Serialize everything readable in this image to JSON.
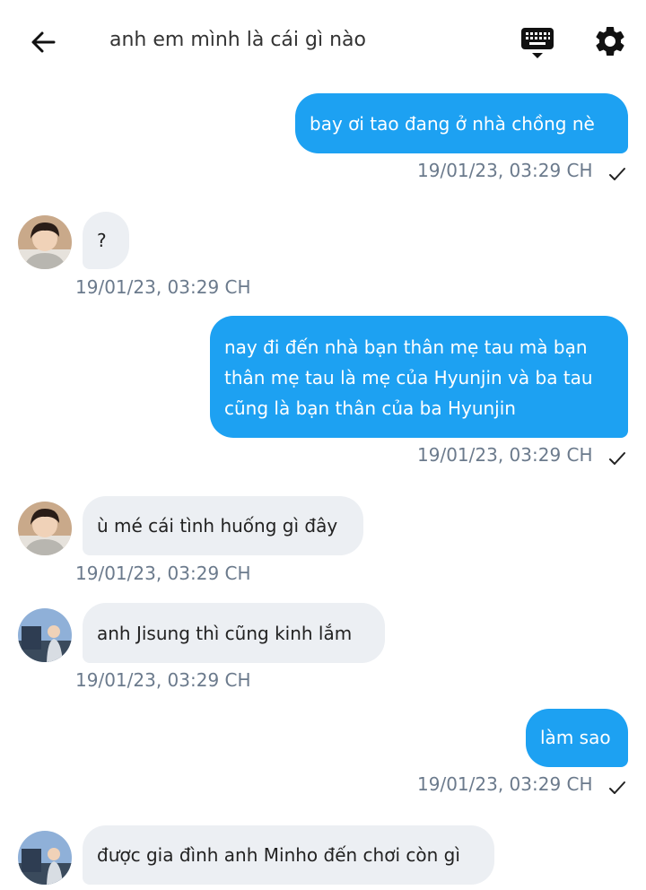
{
  "header": {
    "title": "anh em mình là cái gì nào",
    "back_icon": "arrow-left-icon",
    "keyboard_icon": "keyboard-icon",
    "settings_icon": "gear-icon"
  },
  "colors": {
    "outgoing_bubble": "#1da1f2",
    "incoming_bubble": "#eceff3",
    "timestamp": "#6b7a8c"
  },
  "messages": [
    {
      "direction": "outgoing",
      "text": "bay ơi tao đang ở nhà chồng nè",
      "timestamp": "19/01/23,  03:29 CH",
      "read": true
    },
    {
      "direction": "incoming",
      "avatar": "avatar-person-1",
      "text": "?",
      "timestamp": "19/01/23,  03:29 CH"
    },
    {
      "direction": "outgoing",
      "lines": [
        "nay đi đến nhà bạn thân mẹ tau mà bạn",
        "thân mẹ tau là mẹ của Hyunjin và ba tau",
        "cũng là bạn thân của ba Hyunjin"
      ],
      "timestamp": "19/01/23,  03:29 CH",
      "read": true
    },
    {
      "direction": "incoming",
      "avatar": "avatar-person-1",
      "text": "ù mé cái tình huống gì đây",
      "timestamp": "19/01/23,  03:29 CH"
    },
    {
      "direction": "incoming",
      "avatar": "avatar-person-2",
      "text": "anh Jisung thì cũng kinh lắm",
      "timestamp": "19/01/23,  03:29 CH"
    },
    {
      "direction": "outgoing",
      "text": "làm sao",
      "timestamp": "19/01/23,  03:29 CH",
      "read": true
    },
    {
      "direction": "incoming",
      "avatar": "avatar-person-2",
      "text": "được gia đình anh Minho đến chơi còn gì"
    }
  ]
}
